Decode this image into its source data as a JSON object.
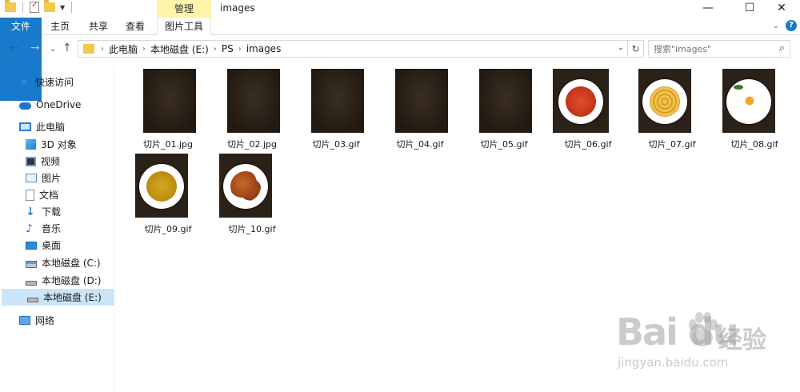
{
  "window": {
    "title": "images",
    "manage_tab": "管理",
    "minimize": "—",
    "maximize": "☐",
    "close": "✕"
  },
  "ribbon": {
    "tabs": [
      "文件",
      "主页",
      "共享",
      "查看",
      "图片工具"
    ],
    "help": "?",
    "collapse": "⌄"
  },
  "nav": {
    "back": "←",
    "forward": "→",
    "recent": "⌄",
    "up": "↑",
    "breadcrumb": [
      "此电脑",
      "本地磁盘 (E:)",
      "PS",
      "images"
    ],
    "refresh": "↻",
    "search_placeholder": "搜索\"images\""
  },
  "sidebar": {
    "items": [
      {
        "label": "快速访问",
        "icon": "star-icon"
      },
      {
        "label": "OneDrive",
        "icon": "cloud-icon"
      },
      {
        "label": "此电脑",
        "icon": "computer-icon"
      },
      {
        "label": "3D 对象",
        "icon": "3d-objects-icon"
      },
      {
        "label": "视频",
        "icon": "video-icon"
      },
      {
        "label": "图片",
        "icon": "pictures-icon"
      },
      {
        "label": "文档",
        "icon": "documents-icon"
      },
      {
        "label": "下载",
        "icon": "download-icon"
      },
      {
        "label": "音乐",
        "icon": "music-icon"
      },
      {
        "label": "桌面",
        "icon": "desktop-icon"
      },
      {
        "label": "本地磁盘 (C:)",
        "icon": "drive-icon"
      },
      {
        "label": "本地磁盘 (D:)",
        "icon": "drive-icon"
      },
      {
        "label": "本地磁盘 (E:)",
        "icon": "drive-icon"
      },
      {
        "label": "网络",
        "icon": "network-icon"
      }
    ],
    "selected": "本地磁盘 (E:)"
  },
  "files": [
    {
      "name": "切片_01.jpg",
      "thumb": "dark-texture"
    },
    {
      "name": "切片_02.jpg",
      "thumb": "dark-texture"
    },
    {
      "name": "切片_03.gif",
      "thumb": "dark-texture"
    },
    {
      "name": "切片_04.gif",
      "thumb": "dark-texture"
    },
    {
      "name": "切片_05.gif",
      "thumb": "dark-texture"
    },
    {
      "name": "切片_06.gif",
      "thumb": "plate-tomato-dish",
      "food_color": "#c8371c"
    },
    {
      "name": "切片_07.gif",
      "thumb": "plate-noodles",
      "food_color": "#e8b23a"
    },
    {
      "name": "切片_08.gif",
      "thumb": "plate-egg",
      "food_color": "#f5a623"
    },
    {
      "name": "切片_09.gif",
      "thumb": "plate-curry-soup",
      "food_color": "#c79a1c"
    },
    {
      "name": "切片_10.gif",
      "thumb": "plate-fried-chicken",
      "food_color": "#b0531e"
    }
  ],
  "watermark": {
    "brand": "Bai du",
    "cn": "经验",
    "url": "jingyan.baidu.com"
  }
}
